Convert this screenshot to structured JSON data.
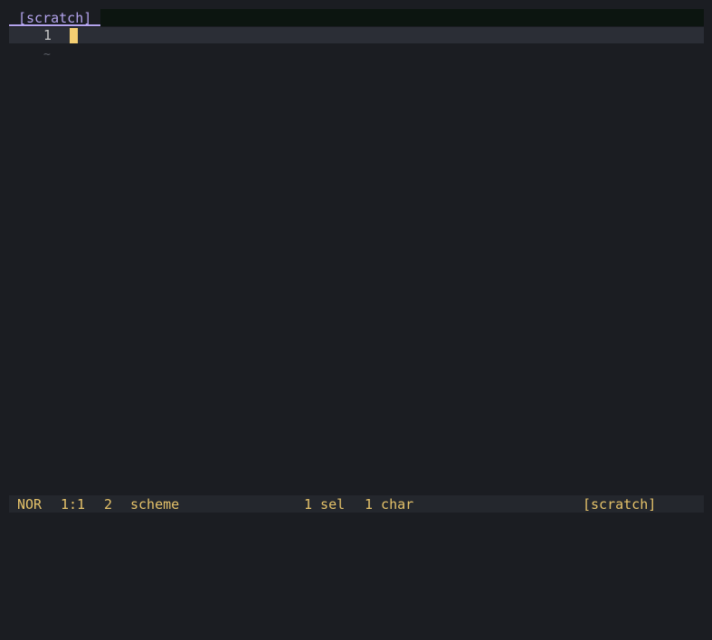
{
  "bufferline": {
    "active_tab": "[scratch]"
  },
  "editor": {
    "line_numbers": [
      "1"
    ],
    "empty_line_marker": "~"
  },
  "statusline": {
    "mode": "NOR",
    "position": "1:1",
    "diagnostics": "2",
    "language": "scheme",
    "selections": "1 sel",
    "chars": "1 char",
    "filename": "[scratch]"
  },
  "colors": {
    "background": "#1b1d22",
    "tab_accent": "#b4a4ee",
    "cursor": "#f5cf72",
    "status_text": "#e6c36a"
  }
}
